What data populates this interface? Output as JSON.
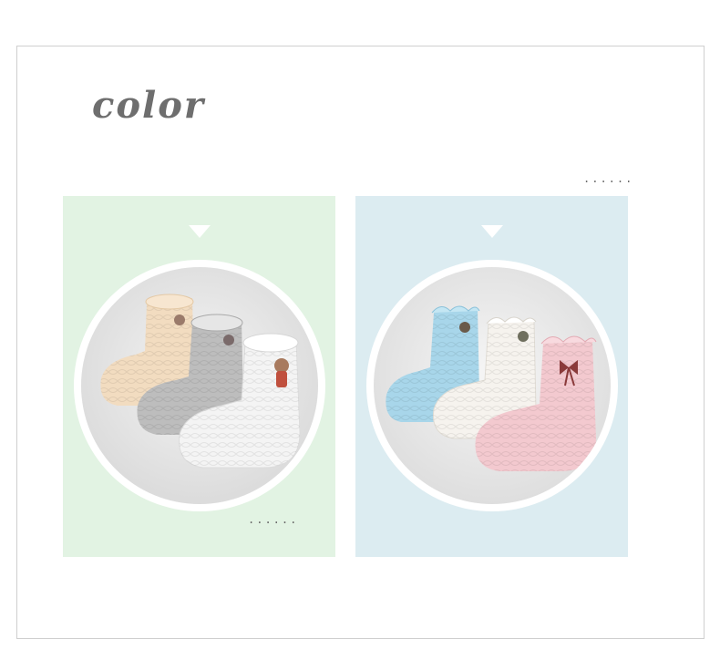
{
  "header": {
    "title": "color",
    "dots_top": "......"
  },
  "panels": [
    {
      "name": "left",
      "background": "#e2f3e3",
      "dots": "......",
      "sock_colors": [
        "#f2dcc0",
        "#bdbdbd",
        "#f4f4f4"
      ]
    },
    {
      "name": "right",
      "background": "#dcecf1",
      "sock_colors": [
        "#a8d6ea",
        "#f6f3ee",
        "#f3c9cf"
      ]
    }
  ]
}
